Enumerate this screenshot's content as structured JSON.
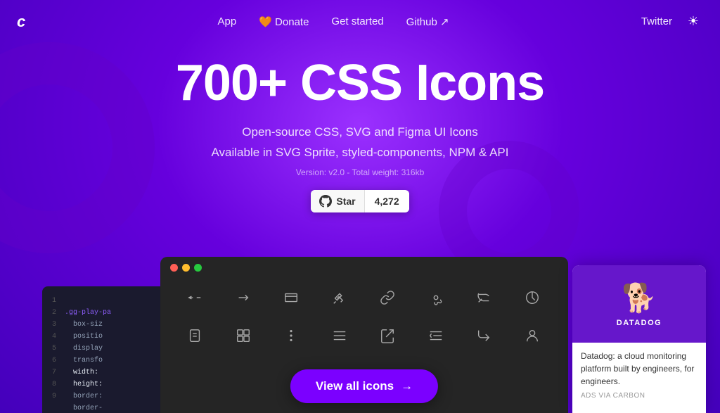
{
  "nav": {
    "logo": "c",
    "links": [
      {
        "label": "App",
        "id": "app"
      },
      {
        "label": "🧡 Donate",
        "id": "donate"
      },
      {
        "label": "Get started",
        "id": "get-started"
      },
      {
        "label": "Github ↗",
        "id": "github"
      }
    ],
    "right": {
      "twitter": "Twitter",
      "theme_icon": "☀"
    }
  },
  "hero": {
    "title": "700+ CSS Icons",
    "subtitle_line1": "Open-source CSS, SVG and Figma UI Icons",
    "subtitle_line2": "Available in SVG Sprite, styled-components, NPM & API",
    "version": "Version: v2.0 - Total weight: 316kb",
    "star_label": "Star",
    "star_count": "4,272"
  },
  "code_panel": {
    "lines": [
      "1",
      "2",
      "3",
      "4",
      "5",
      "6",
      "7",
      "8",
      "9"
    ],
    "code": [
      ".gg-play-pa",
      "  box-siz",
      "  positio",
      "  display",
      "  transfo",
      "  width:",
      "  height:",
      "  border:",
      "  border-"
    ]
  },
  "icons_panel": {
    "view_all_label": "View all icons",
    "view_all_arrow": "→"
  },
  "ad": {
    "brand": "DATADOG",
    "tagline": "Datadog: a cloud monitoring platform built by engineers, for engineers.",
    "via": "ADS VIA CARBON"
  }
}
